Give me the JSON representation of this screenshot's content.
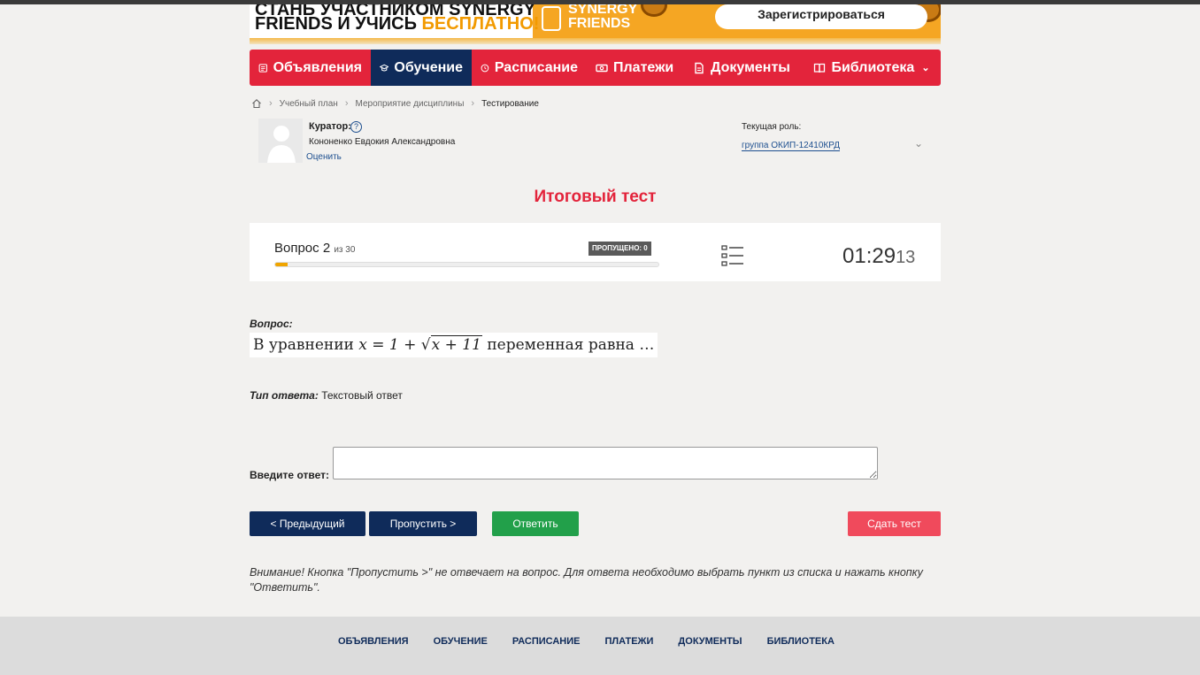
{
  "banner": {
    "line1": "СТАНЬ УЧАСТНИКОМ SYNERGY",
    "line2_prefix": "FRIENDS И УЧИСЬ ",
    "line2_highlight": "БЕСПЛАТНО!",
    "logo_line1": "SYNERGY",
    "logo_line2": "FRIENDS",
    "register_label": "Зарегистрироваться"
  },
  "nav": {
    "items": [
      {
        "label": "Объявления",
        "icon": "announcement-icon"
      },
      {
        "label": "Обучение",
        "icon": "graduation-cap-icon",
        "active": true
      },
      {
        "label": "Расписание",
        "icon": "clock-icon"
      },
      {
        "label": "Платежи",
        "icon": "money-icon"
      },
      {
        "label": "Документы",
        "icon": "document-icon"
      },
      {
        "label": "Библиотека",
        "icon": "book-icon"
      }
    ]
  },
  "breadcrumb": {
    "items": [
      "Учебный план",
      "Мероприятие дисциплины",
      "Тестирование"
    ]
  },
  "curator": {
    "label": "Куратор:",
    "name": "Кононенко Евдокия Александровна",
    "rate_label": "Оценить"
  },
  "role": {
    "label": "Текущая роль:",
    "value": "группа ОКИП-12410КРД"
  },
  "test": {
    "title": "Итоговый тест",
    "question_word": "Вопрос",
    "question_number": "2",
    "question_total": "из 30",
    "progress_fraction": 0.033,
    "skipped_label": "ПРОПУЩЕНО: 0",
    "timer_main": "01:29",
    "timer_seconds": "13"
  },
  "question": {
    "label": "Вопрос:",
    "text_before": "В уравнении",
    "equation_lhs": "x = 1 + ",
    "equation_sqrt": "x + 11",
    "text_after": "переменная равна …",
    "type_label": "Тип ответа:",
    "type_value": "Текстовый ответ"
  },
  "answer": {
    "label": "Введите ответ:",
    "value": ""
  },
  "buttons": {
    "prev": "< Предыдущий",
    "skip": "Пропустить >",
    "answer": "Ответить",
    "submit": "Сдать тест"
  },
  "note": "Внимание! Кнопка \"Пропустить >\" не отвечает на вопрос. Для ответа необходимо выбрать пункт из списка и нажать кнопку \"Ответить\".",
  "footer": {
    "items": [
      "ОБЪЯВЛЕНИЯ",
      "ОБУЧЕНИЕ",
      "РАСПИСАНИЕ",
      "ПЛАТЕЖИ",
      "ДОКУМЕНТЫ",
      "БИБЛИОТЕКА"
    ]
  },
  "colors": {
    "accent_red": "#e3243b",
    "navy": "#0f2b5a",
    "green": "#22a04a",
    "banner_orange": "#f5a623"
  }
}
